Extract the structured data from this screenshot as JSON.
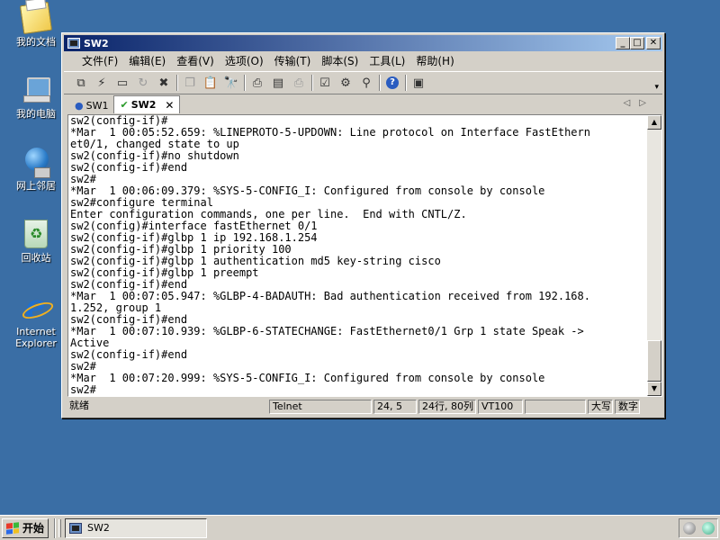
{
  "desktop": {
    "icons": [
      {
        "label": "我的文档",
        "icon": "my-documents-icon"
      },
      {
        "label": "我的电脑",
        "icon": "my-computer-icon"
      },
      {
        "label": "网上邻居",
        "icon": "network-places-icon"
      },
      {
        "label": "回收站",
        "icon": "recycle-bin-icon"
      },
      {
        "label": "Internet Explorer",
        "icon": "internet-explorer-icon"
      }
    ]
  },
  "window": {
    "title": "SW2",
    "controls": {
      "minimize": "_",
      "maximize": "□",
      "close": "✕"
    },
    "menu": [
      "文件(F)",
      "编辑(E)",
      "查看(V)",
      "选项(O)",
      "传输(T)",
      "脚本(S)",
      "工具(L)",
      "帮助(H)"
    ],
    "toolbar": {
      "icons": [
        "connect-icon",
        "quick-connect-icon",
        "connect-tab-icon",
        "reconnect-icon",
        "disconnect-icon",
        "copy-icon",
        "paste-icon",
        "find-icon",
        "print-icon",
        "print-setup-icon",
        "print-screen-icon",
        "session-options-icon",
        "global-options-icon",
        "keymap-icon",
        "help-icon",
        "screenshot-icon"
      ]
    },
    "tabs": [
      {
        "label": "SW1",
        "icon": "info-icon",
        "active": false
      },
      {
        "label": "SW2",
        "icon": "checkmark-icon",
        "active": true
      }
    ],
    "tab_close": "✕",
    "terminal": {
      "lines": [
        "sw2(config-if)#",
        "*Mar  1 00:05:52.659: %LINEPROTO-5-UPDOWN: Line protocol on Interface FastEthern",
        "et0/1, changed state to up",
        "sw2(config-if)#no shutdown",
        "sw2(config-if)#end",
        "sw2#",
        "*Mar  1 00:06:09.379: %SYS-5-CONFIG_I: Configured from console by console",
        "sw2#configure terminal",
        "Enter configuration commands, one per line.  End with CNTL/Z.",
        "sw2(config)#interface fastEthernet 0/1",
        "sw2(config-if)#glbp 1 ip 192.168.1.254",
        "sw2(config-if)#glbp 1 priority 100",
        "sw2(config-if)#glbp 1 authentication md5 key-string cisco",
        "sw2(config-if)#glbp 1 preempt",
        "sw2(config-if)#end",
        "*Mar  1 00:07:05.947: %GLBP-4-BADAUTH: Bad authentication received from 192.168.",
        "1.252, group 1",
        "sw2(config-if)#end",
        "*Mar  1 00:07:10.939: %GLBP-6-STATECHANGE: FastEthernet0/1 Grp 1 state Speak ->",
        "Active",
        "sw2(config-if)#end",
        "sw2#",
        "*Mar  1 00:07:20.999: %SYS-5-CONFIG_I: Configured from console by console",
        "sw2#"
      ]
    },
    "status": {
      "ready": "就绪",
      "protocol": "Telnet",
      "cursor": "24,  5",
      "size": "24行, 80列",
      "emulation": "VT100",
      "caps": "大写",
      "num": "数字"
    }
  },
  "taskbar": {
    "start_label": "开始",
    "task_label": "SW2"
  }
}
